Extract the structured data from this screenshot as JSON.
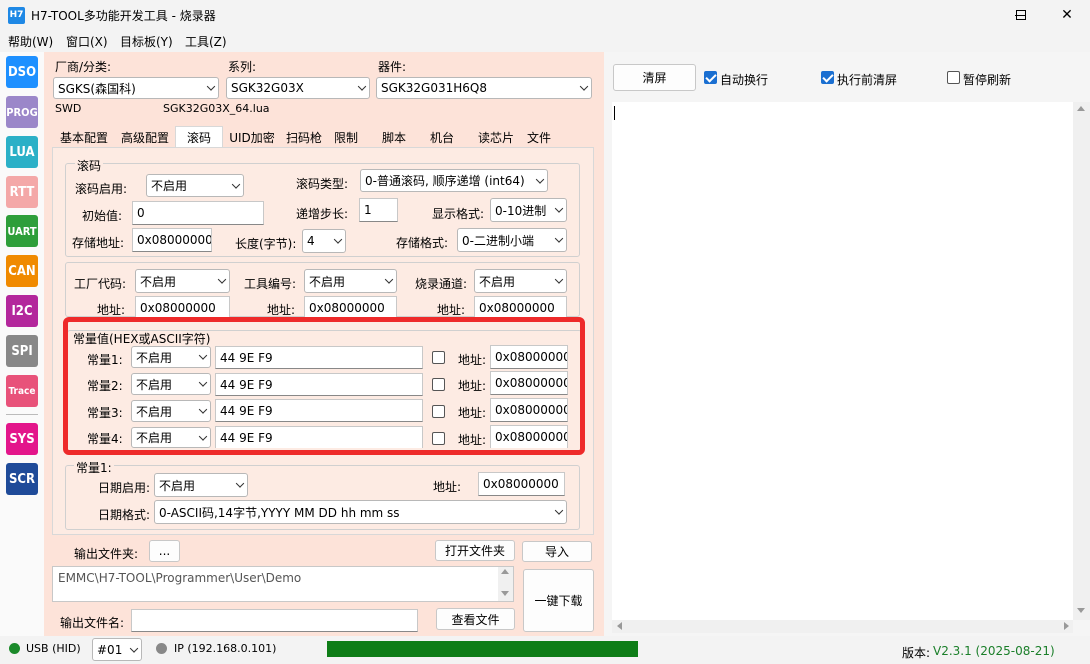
{
  "window": {
    "title": "H7-TOOL多功能开发工具 - 烧录器",
    "icon_text": "H7"
  },
  "menu": [
    "帮助(W)",
    "窗口(X)",
    "目标板(Y)",
    "工具(Z)"
  ],
  "sidebar": [
    "DSO",
    "PROG",
    "LUA",
    "RTT",
    "UART",
    "CAN",
    "I2C",
    "SPI",
    "Trace",
    "SYS",
    "SCR"
  ],
  "colors": {
    "dso": "#1e90ff",
    "prog": "#9b87c9",
    "lua": "#2bb0c7",
    "rtt": "#f4a8a8",
    "uart": "#2e9e3a",
    "can": "#f08a00",
    "i2c": "#b3279c",
    "spi": "#888888",
    "trace": "#e8527a",
    "sys": "#e3168b",
    "scr": "#1f4b99",
    "highlight": "#ee2a2a",
    "progress": "#0e7d17"
  },
  "device": {
    "vendor_label": "厂商/分类:",
    "vendor": "SGKS(森国科)",
    "series_label": "系列:",
    "series": "SGK32G03X",
    "part_label": "器件:",
    "part": "SGK32G031H6Q8",
    "iface": "SWD",
    "lua_file": "SGK32G03X_64.lua"
  },
  "tabs": [
    "基本配置",
    "高级配置",
    "滚码",
    "UID加密",
    "扫码枪",
    "限制",
    "脚本",
    "机台",
    "读芯片",
    "文件"
  ],
  "rolling": {
    "group_title": "滚码",
    "enable_label": "滚码启用:",
    "enable": "不启用",
    "type_label": "滚码类型:",
    "type": "0-普通滚码, 顺序递增  (int64)",
    "init_label": "初始值:",
    "init": "0",
    "step_label": "递增步长:",
    "step": "1",
    "display_label": "显示格式:",
    "display": "0-10进制",
    "addr_label": "存储地址:",
    "addr": "0x08000000",
    "len_label": "长度(字节):",
    "len": "4",
    "store_label": "存储格式:",
    "store": "0-二进制小端"
  },
  "factory": {
    "code_label": "工厂代码:",
    "code": "不启用",
    "tool_label": "工具编号:",
    "tool": "不启用",
    "chan_label": "烧录通道:",
    "chan": "不启用",
    "addr_label": "地址:",
    "addr1": "0x08000000",
    "addr2": "0x08000000",
    "addr3": "0x08000000"
  },
  "constants": {
    "group_title": "常量值(HEX或ASCII字符)",
    "addr_label": "地址:",
    "rows": [
      {
        "label": "常量1:",
        "mode": "不启用",
        "value": "44 9E F9",
        "addr": "0x08000000"
      },
      {
        "label": "常量2:",
        "mode": "不启用",
        "value": "44 9E F9",
        "addr": "0x08000000"
      },
      {
        "label": "常量3:",
        "mode": "不启用",
        "value": "44 9E F9",
        "addr": "0x08000000"
      },
      {
        "label": "常量4:",
        "mode": "不启用",
        "value": "44 9E F9",
        "addr": "0x08000000"
      }
    ]
  },
  "date": {
    "group_title": "常量1:",
    "enable_label": "日期启用:",
    "enable": "不启用",
    "addr_label": "地址:",
    "addr": "0x08000000",
    "format_label": "日期格式:",
    "format": "0-ASCII码,14字节,YYYY MM DD hh mm ss"
  },
  "output": {
    "folder_label": "输出文件夹:",
    "browse": "...",
    "open_folder": "打开文件夹",
    "import": "导入",
    "path": "EMMC\\H7-TOOL\\Programmer\\User\\Demo",
    "filename_label": "输出文件名:",
    "filename": "",
    "view_file": "查看文件",
    "download": "一键下载"
  },
  "log": {
    "clear": "清屏",
    "auto_wrap": "自动换行",
    "auto_wrap_on": true,
    "clear_before": "执行前清屏",
    "clear_before_on": true,
    "pause": "暂停刷新",
    "pause_on": false
  },
  "status": {
    "usb": "USB (HID)",
    "port": "#01",
    "ip": "IP (192.168.0.101)",
    "version_label": "版本:",
    "version": "V2.3.1 (2025-08-21)",
    "progress": 1.0
  }
}
